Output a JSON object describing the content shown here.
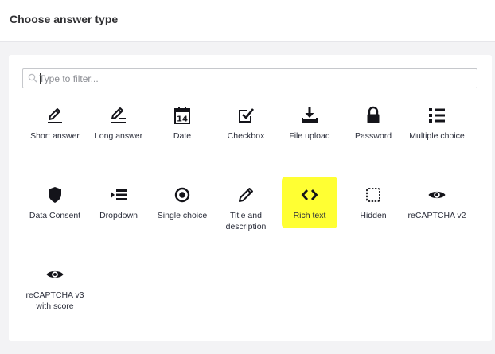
{
  "header": {
    "title": "Choose answer type"
  },
  "filter": {
    "placeholder": "Type to filter...",
    "value": ""
  },
  "colors": {
    "highlight": "#ffff33",
    "icon": "#14141a"
  },
  "answer_types": [
    {
      "label": "Short answer",
      "icon": "pen-line-icon"
    },
    {
      "label": "Long answer",
      "icon": "pen-lines-icon"
    },
    {
      "label": "Date",
      "icon": "calendar-icon",
      "day": "14"
    },
    {
      "label": "Checkbox",
      "icon": "checkbox-icon"
    },
    {
      "label": "File upload",
      "icon": "upload-icon"
    },
    {
      "label": "Password",
      "icon": "lock-icon"
    },
    {
      "label": "Multiple choice",
      "icon": "list-icon"
    },
    {
      "label": "Data Consent",
      "icon": "shield-icon"
    },
    {
      "label": "Dropdown",
      "icon": "dropdown-list-icon"
    },
    {
      "label": "Single choice",
      "icon": "radio-icon"
    },
    {
      "label": "Title and description",
      "icon": "pencil-icon"
    },
    {
      "label": "Rich text",
      "icon": "code-icon"
    },
    {
      "label": "Hidden",
      "icon": "dashed-square-icon"
    },
    {
      "label": "reCAPTCHA v2",
      "icon": "eye-icon"
    },
    {
      "label": "reCAPTCHA v3 with score",
      "icon": "eye-icon"
    }
  ]
}
